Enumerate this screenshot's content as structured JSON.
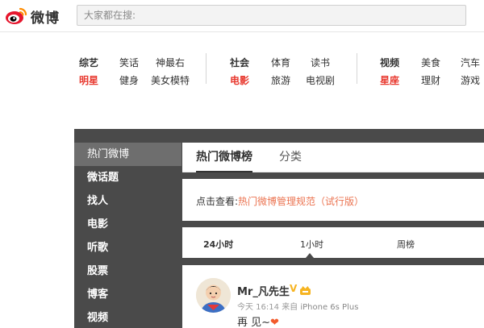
{
  "brand": {
    "name": "微博"
  },
  "search": {
    "placeholder": "大家都在搜:"
  },
  "channels": {
    "group1": [
      {
        "label": "综艺",
        "style": "bold"
      },
      {
        "label": "笑话",
        "style": "normal"
      },
      {
        "label": "神最右",
        "style": "normal"
      },
      {
        "label": "明星",
        "style": "red"
      },
      {
        "label": "健身",
        "style": "normal"
      },
      {
        "label": "美女模特",
        "style": "normal"
      }
    ],
    "group2": [
      {
        "label": "社会",
        "style": "bold"
      },
      {
        "label": "体育",
        "style": "normal"
      },
      {
        "label": "读书",
        "style": "normal"
      },
      {
        "label": "电影",
        "style": "red"
      },
      {
        "label": "旅游",
        "style": "normal"
      },
      {
        "label": "电视剧",
        "style": "normal"
      }
    ],
    "group3": [
      {
        "label": "视频",
        "style": "bold"
      },
      {
        "label": "美食",
        "style": "normal"
      },
      {
        "label": "汽车",
        "style": "normal"
      },
      {
        "label": "星座",
        "style": "red"
      },
      {
        "label": "理财",
        "style": "normal"
      },
      {
        "label": "游戏",
        "style": "normal"
      }
    ]
  },
  "sidebar": {
    "items": [
      {
        "label": "热门微博"
      },
      {
        "label": "微话题"
      },
      {
        "label": "找人"
      },
      {
        "label": "电影"
      },
      {
        "label": "听歌"
      },
      {
        "label": "股票"
      },
      {
        "label": "博客"
      },
      {
        "label": "视频"
      }
    ]
  },
  "tabs": {
    "hot": "热门微博榜",
    "category": "分类"
  },
  "notice": {
    "prefix": "点击查看:",
    "link": "热门微博管理规范（试行版）"
  },
  "time_tabs": {
    "day": "24小时",
    "hour": "1小时",
    "week": "周榜"
  },
  "post": {
    "username": "Mr_凡先生",
    "verified_mark": "V",
    "meta_time": "今天 16:14",
    "meta_from": "来自",
    "meta_device": "iPhone 6s Plus",
    "text": "再 见~",
    "heart": "❤"
  },
  "colors": {
    "accent_red": "#e8392f",
    "link_orange": "#eb7350",
    "dark_band": "#4a4a4a",
    "sidebar_active": "#6e6e6e"
  }
}
